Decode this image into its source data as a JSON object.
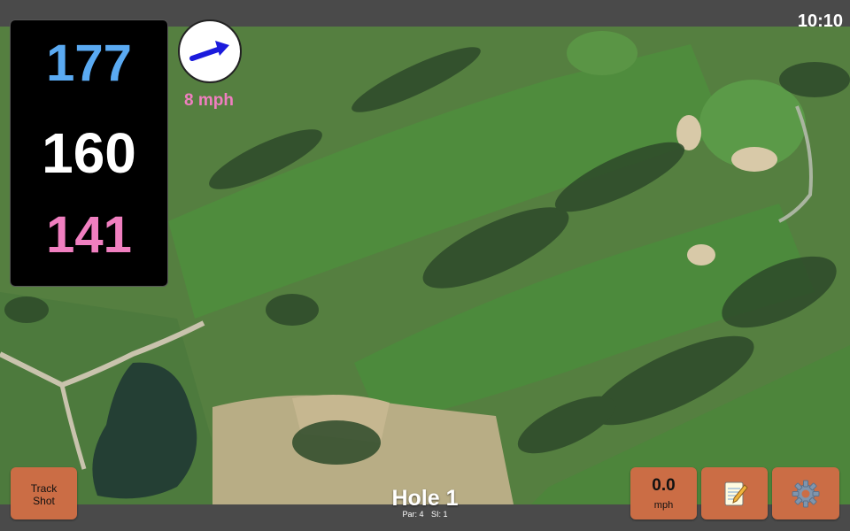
{
  "status_bar": {
    "time": "10:10"
  },
  "yardage": {
    "back": "177",
    "middle": "160",
    "front": "141"
  },
  "wind": {
    "speed_label": "8 mph"
  },
  "hole": {
    "title": "Hole 1",
    "par": "Par: 4",
    "stroke_index": "SI: 1"
  },
  "buttons": {
    "track_shot_line1": "Track",
    "track_shot_line2": "Shot",
    "speed_value": "0.0",
    "speed_unit": "mph"
  },
  "icons": {
    "wind_direction": "arrow-icon",
    "notes": "notepad-icon",
    "settings": "gear-icon"
  },
  "colors": {
    "back_yardage": "#5aaaf2",
    "middle_yardage": "#ffffff",
    "front_yardage": "#f07fc0",
    "wind_label": "#f07fc0",
    "wind_arrow": "#1b1bdc",
    "button": "#cb6d45"
  }
}
